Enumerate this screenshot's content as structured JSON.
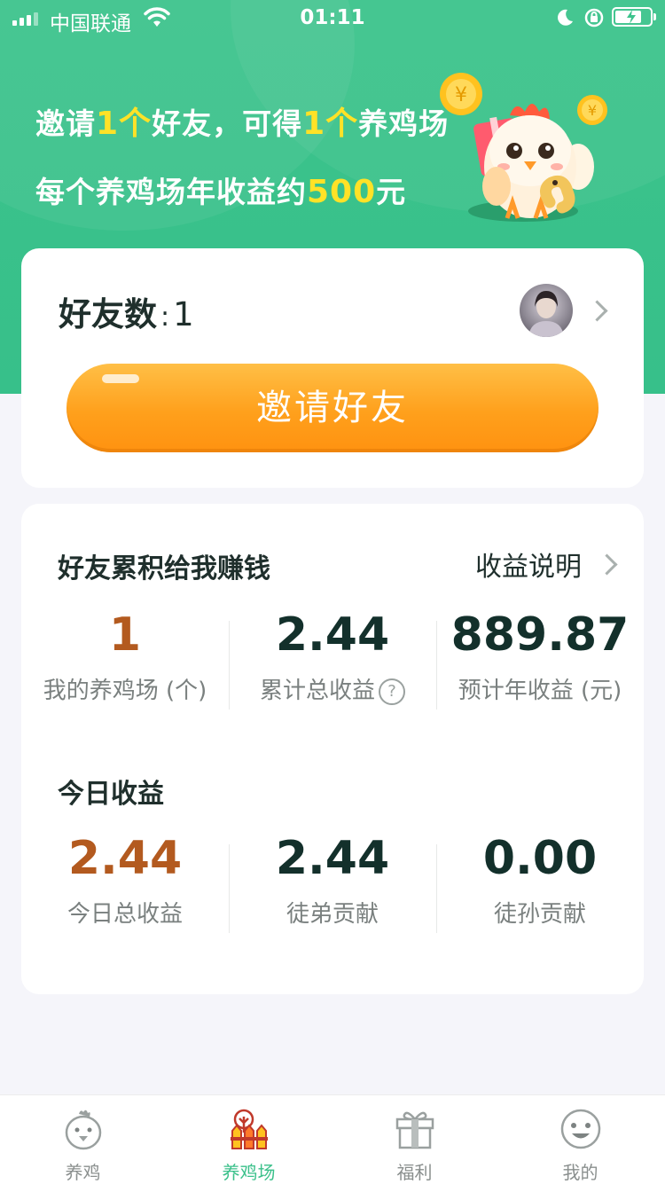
{
  "status_bar": {
    "carrier": "中国联通",
    "time": "01:11",
    "battery_level": 0.75
  },
  "promo": {
    "line1_a": "邀请",
    "line1_b": "1个",
    "line1_c": "好友，可得",
    "line1_d": "1个",
    "line1_e": "养鸡场",
    "line2_a": "每个养鸡场年收益约",
    "line2_b": "500",
    "line2_c": "元"
  },
  "friends_card": {
    "label": "好友数",
    "colon": ":",
    "count": "1",
    "invite_button": "邀请好友"
  },
  "earnings": {
    "title": "好友累积给我赚钱",
    "explain_link": "收益说明",
    "stats": [
      {
        "value": "1",
        "label": "我的养鸡场 (个)"
      },
      {
        "value": "2.44",
        "label": "累计总收益"
      },
      {
        "value": "889.87",
        "label": "预计年收益 (元)"
      }
    ],
    "help_mark": "?"
  },
  "today": {
    "title": "今日收益",
    "stats": [
      {
        "value": "2.44",
        "label": "今日总收益"
      },
      {
        "value": "2.44",
        "label": "徒弟贡献"
      },
      {
        "value": "0.00",
        "label": "徒孙贡献"
      }
    ]
  },
  "tabbar": {
    "tabs": [
      {
        "label": "养鸡",
        "icon": "chicken-icon"
      },
      {
        "label": "养鸡场",
        "icon": "farm-icon"
      },
      {
        "label": "福利",
        "icon": "gift-icon"
      },
      {
        "label": "我的",
        "icon": "smiley-icon"
      }
    ],
    "active": "养鸡场"
  },
  "colors": {
    "brand_green": "#3cc38c",
    "highlight_yellow": "#ffe227",
    "button_orange": "#ffa01c",
    "accent_brown": "#b35a1f"
  }
}
